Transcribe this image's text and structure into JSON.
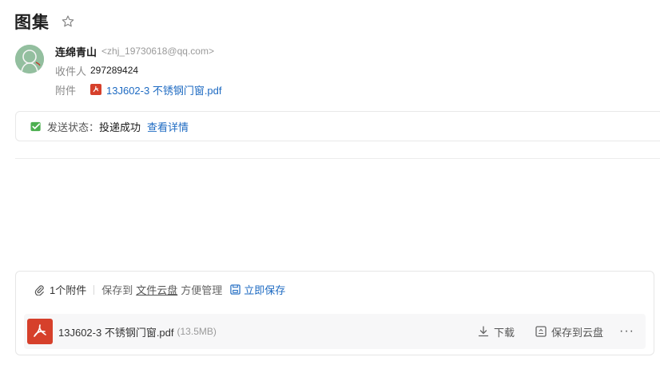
{
  "header": {
    "title": "图集"
  },
  "sender": {
    "name": "连绵青山",
    "email": "<zhj_19730618@qq.com>",
    "recipient_label": "收件人",
    "recipient_value": "297289424",
    "attachment_label": "附件",
    "attachment_link": "13J602-3 不锈钢门窗.pdf"
  },
  "status": {
    "label": "发送状态：",
    "value": "投递成功",
    "details_link": "查看详情"
  },
  "attachments": {
    "count_text": "1个附件",
    "save_to_text": "保存到",
    "cloud_text": "文件云盘",
    "convenient_text": "方便管理",
    "save_now": "立即保存",
    "file": {
      "name": "13J602-3 不锈钢门窗.pdf",
      "size": "(13.5MB)",
      "download": "下载",
      "save_to_cloud": "保存到云盘",
      "more": "···"
    }
  },
  "colors": {
    "link": "#1d6ac2",
    "pdf": "#d6402b",
    "success": "#4caf50"
  },
  "icons": [
    "star-icon",
    "avatar",
    "pdf-icon",
    "check-icon",
    "paperclip-icon",
    "save-icon",
    "download-icon",
    "cloud-save-icon",
    "more-icon"
  ]
}
